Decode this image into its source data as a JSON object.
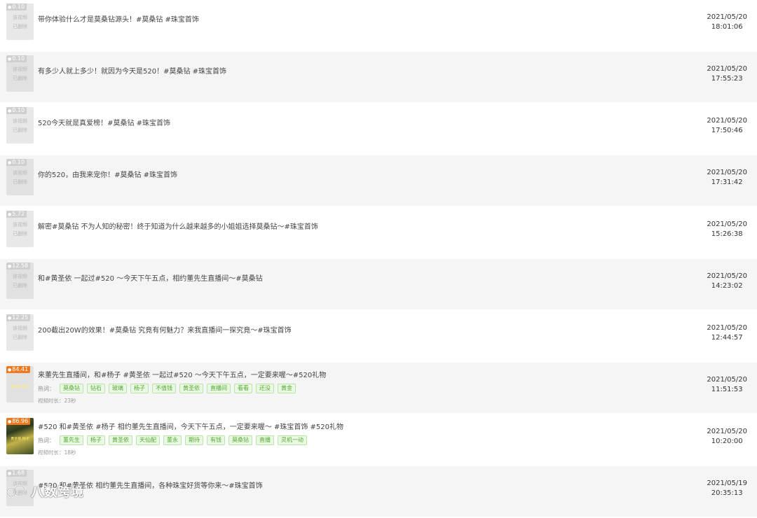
{
  "rows": [
    {
      "badge": "0.10",
      "deleted": "该视频\n已删除",
      "title": "带你体验什么才是莫桑钻源头！#莫桑钻 #珠宝首饰",
      "date": "2021/05/20",
      "time": "18:01:06"
    },
    {
      "badge": "0.10",
      "deleted": "该视频\n已删除",
      "title": "有多少人就上多少！就因为今天是520！#莫桑钻 #珠宝首饰",
      "date": "2021/05/20",
      "time": "17:55:23"
    },
    {
      "badge": "0.10",
      "deleted": "该视频\n已删除",
      "title": "520今天就是真爱榜！#莫桑钻 #珠宝首饰",
      "date": "2021/05/20",
      "time": "17:50:46"
    },
    {
      "badge": "0.10",
      "deleted": "该视频\n已删除",
      "title": "你的520，由我来宠你！#莫桑钻 #珠宝首饰",
      "date": "2021/05/20",
      "time": "17:31:42"
    },
    {
      "badge": "5.72",
      "deleted": "该视频\n已删除",
      "title": "解密#莫桑钻 不为人知的秘密！终于知道为什么越来越多的小姐姐选择莫桑钻～#珠宝首饰",
      "date": "2021/05/20",
      "time": "15:26:38"
    },
    {
      "badge": "12.58",
      "deleted": "该视频\n已删除",
      "title": "和#黄圣依 一起过#520 ～今天下午五点，相约董先生直播间～#莫桑钻",
      "date": "2021/05/20",
      "time": "14:23:02"
    },
    {
      "badge": "12.25",
      "deleted": "该视频\n已删除",
      "title": "200截出20W的效果！#莫桑钻 究竟有何魅力？来我直播间一探究竟～#珠宝首饰",
      "date": "2021/05/20",
      "time": "12:44:57"
    },
    {
      "badge": "84.41",
      "title": "来董先生直播间，和#杨子 #黄圣依 一起过#520 ～今天下午五点，一定要来喔～#520礼物",
      "tags_label": "热词：",
      "tags": [
        "莫桑钻",
        "钻石",
        "玻璃",
        "杨子",
        "不值钱",
        "黄圣依",
        "直播间",
        "看看",
        "还没",
        "黄金"
      ],
      "duration": "视频时长：23秒",
      "thumb_overlay": "黄圣依 杨子",
      "date": "2021/05/20",
      "time": "11:51:53"
    },
    {
      "badge": "86.96",
      "title": "#520 和#黄圣依 #杨子 相约董先生直播间，今天下午五点，一定要来喔～ #珠宝首饰 #520礼物",
      "tags_label": "热词：",
      "tags": [
        "董先生",
        "杨子",
        "黄圣依",
        "天仙配",
        "董永",
        "期待",
        "有钱",
        "莫桑钻",
        "直播",
        "灵机一动"
      ],
      "duration": "视频时长：18秒",
      "thumb_overlay": "黄圣依 杨子",
      "date": "2021/05/20",
      "time": "10:20:00"
    },
    {
      "badge": "1.68",
      "deleted": "该视频\n已删除",
      "title": "#520 和#黄圣依 相约董先生直播间，各种珠宝好货等你来～#珠宝首饰",
      "date": "2021/05/19",
      "time": "20:35:13"
    }
  ],
  "watermark": {
    "text": "八数跨境",
    "icon": "logo-icon"
  },
  "colors": {
    "alt_row": "#f5f5f5",
    "tag_bg": "#eaf9e3",
    "tag_text": "#55a833",
    "badge_video": "#f07a1d",
    "badge_deleted": "#cfcfcf"
  }
}
